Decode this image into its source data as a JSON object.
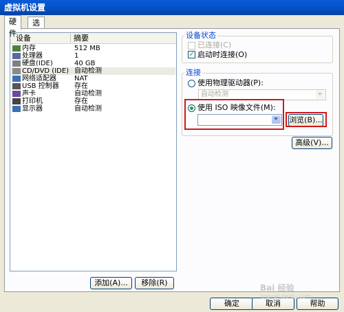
{
  "window": {
    "title": "虚拟机设置"
  },
  "tabs": [
    {
      "label": "硬件"
    },
    {
      "label": "选项"
    }
  ],
  "device_list": {
    "headers": {
      "device": "设备",
      "summary": "摘要"
    },
    "rows": [
      {
        "icon": "memory-icon",
        "device": "内存",
        "summary": "512 MB"
      },
      {
        "icon": "processor-icon",
        "device": "处理器",
        "summary": "1"
      },
      {
        "icon": "hard-disk-icon",
        "device": "硬盘(IDE)",
        "summary": "40 GB"
      },
      {
        "icon": "cd-dvd-icon",
        "device": "CD/DVD (IDE)",
        "summary": "自动检测"
      },
      {
        "icon": "network-adapter-icon",
        "device": "网络适配器",
        "summary": "NAT"
      },
      {
        "icon": "usb-icon",
        "device": "USB 控制器",
        "summary": "存在"
      },
      {
        "icon": "sound-icon",
        "device": "声卡",
        "summary": "自动检测"
      },
      {
        "icon": "printer-icon",
        "device": "打印机",
        "summary": "存在"
      },
      {
        "icon": "display-icon",
        "device": "显示器",
        "summary": "自动检测"
      }
    ]
  },
  "device_status": {
    "title": "设备状态",
    "connected": {
      "label": "已连接(C)",
      "checked": false,
      "enabled": false
    },
    "connect_at_power_on": {
      "label": "启动时连接(O)",
      "checked": true
    }
  },
  "connection": {
    "title": "连接",
    "physical_drive": {
      "label": "使用物理驱动器(P):",
      "selected": false,
      "value": "自动检测"
    },
    "iso_image": {
      "label": "使用 ISO 映像文件(M):",
      "selected": true,
      "value": ""
    },
    "browse_label": "浏览(B)...",
    "advanced_label": "高级(V)..."
  },
  "buttons": {
    "add": "添加(A)...",
    "remove": "移除(R)",
    "ok": "确定",
    "cancel": "取消",
    "help": "帮助"
  },
  "watermark": {
    "text": "Bai 经验",
    "sub": "jingyan.baidu.com"
  },
  "colors": {
    "title_bar": "#0a5bd7",
    "highlight": "#d01818",
    "check": "#21a121"
  }
}
